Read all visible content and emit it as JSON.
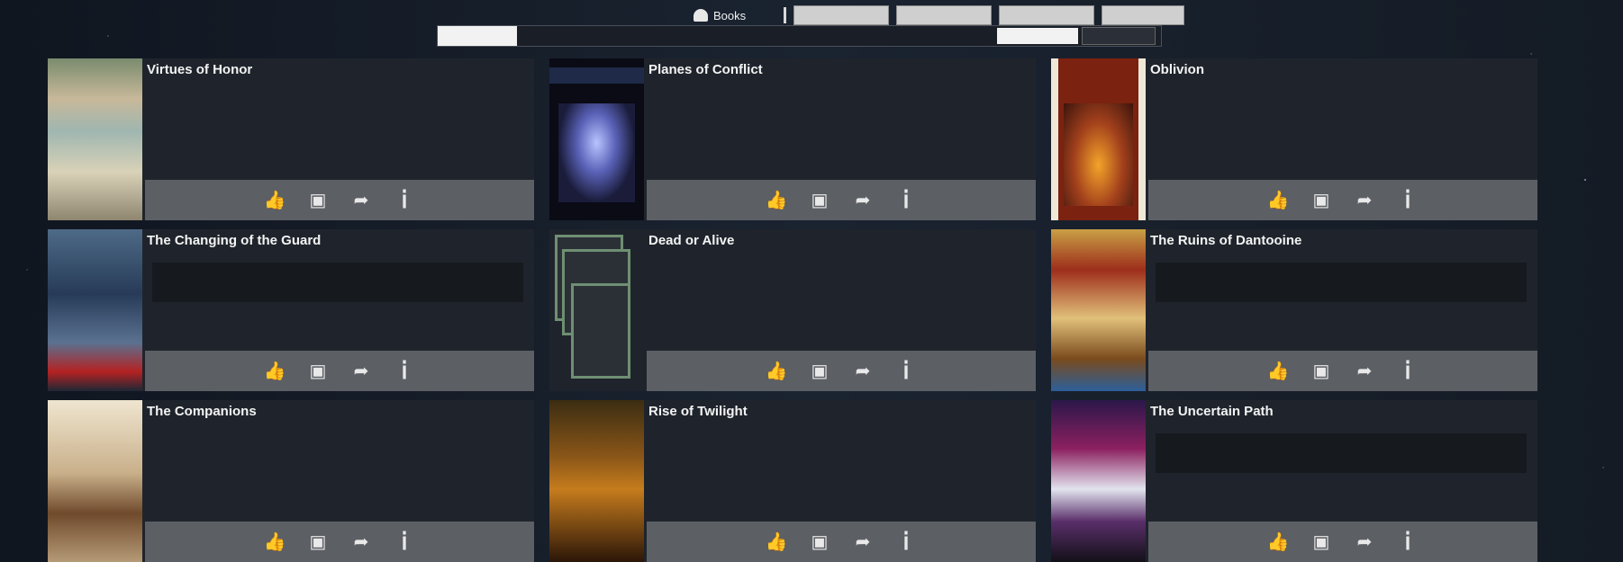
{
  "header": {
    "brand_label": "Books",
    "nav_buttons": [
      "",
      "",
      "",
      ""
    ],
    "modes": [
      "",
      "",
      ""
    ],
    "filter_text": "",
    "sort_label": "",
    "sort_value": ""
  },
  "cards": [
    {
      "title": "Virtues of Honor",
      "author": "",
      "summary": "",
      "meta": "",
      "notice": "",
      "cover": "c1"
    },
    {
      "title": "Planes of Conflict",
      "author": "",
      "summary": "",
      "meta": "",
      "notice": "",
      "cover": "c2"
    },
    {
      "title": "Oblivion",
      "author": "",
      "summary": "",
      "meta": "",
      "notice": "",
      "cover": "c3"
    },
    {
      "title": "The Changing of the Guard",
      "author": "",
      "summary": "",
      "meta": "",
      "notice": "",
      "cover": "c4"
    },
    {
      "title": "Dead or Alive",
      "author": "",
      "summary": "",
      "meta": "",
      "notice": "",
      "cover": "c5"
    },
    {
      "title": "The Ruins of Dantooine",
      "author": "",
      "summary": "",
      "meta": "",
      "notice": "",
      "cover": "c6"
    },
    {
      "title": "The Companions",
      "author": "",
      "summary": "",
      "meta": "",
      "notice": "",
      "cover": "c7"
    },
    {
      "title": "Rise of Twilight",
      "author": "",
      "summary": "",
      "meta": "",
      "notice": "",
      "cover": "c8"
    },
    {
      "title": "The Uncertain Path",
      "author": "",
      "summary": "",
      "meta": "",
      "notice": "",
      "cover": "c9"
    }
  ],
  "action_icons": [
    "thumbs-up-icon",
    "bookmark-icon",
    "share-icon",
    "info-icon"
  ],
  "colors": {
    "card_bg": "#1f242c",
    "action_bar": "#5c5f64"
  }
}
